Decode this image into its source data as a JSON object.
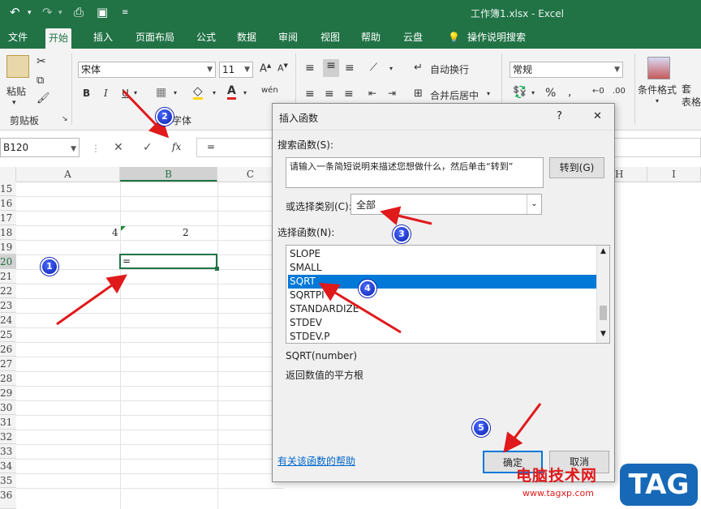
{
  "title_bar": {
    "title": "工作簿1.xlsx  -  Excel"
  },
  "tabs": [
    {
      "label": "文件"
    },
    {
      "label": "开始"
    },
    {
      "label": "插入"
    },
    {
      "label": "页面布局"
    },
    {
      "label": "公式"
    },
    {
      "label": "数据"
    },
    {
      "label": "审阅"
    },
    {
      "label": "视图"
    },
    {
      "label": "帮助"
    },
    {
      "label": "云盘"
    },
    {
      "label": "操作说明搜索"
    }
  ],
  "ribbon": {
    "paste_label": "粘贴",
    "clipboard_label": "剪贴板",
    "font_group_label": "字体",
    "font_name": "宋体",
    "font_size": "11",
    "wrap_text": "自动换行",
    "merge_center": "合并后居中",
    "number_format": "常规",
    "conditional_format": "条件格式",
    "table_format_partial": "套\n表格",
    "bold": "B",
    "italic": "I",
    "underline": "U",
    "font_color": "A",
    "wen": "wén",
    "percent": "%"
  },
  "formula_bar": {
    "name_box": "B120",
    "fx": "fx",
    "formula": "="
  },
  "columns": [
    "A",
    "B",
    "C",
    "H",
    "I"
  ],
  "rows": [
    "15",
    "16",
    "17",
    "18",
    "19",
    "20",
    "21",
    "22",
    "23",
    "24",
    "25",
    "26",
    "27",
    "28",
    "29",
    "30",
    "31",
    "32",
    "33",
    "34",
    "35",
    "36"
  ],
  "cells": {
    "A18": "4",
    "B18": "2",
    "B20": "="
  },
  "dialog": {
    "title": "插入函数",
    "help": "?",
    "close": "✕",
    "search_label": "搜索函数(S):",
    "search_text": "请输入一条简短说明来描述您想做什么，然后单击“转到”",
    "go_button": "转到(G)",
    "category_label": "或选择类别(C):",
    "category_value": "全部",
    "select_label": "选择函数(N):",
    "functions": [
      "SLOPE",
      "SMALL",
      "SQRT",
      "SQRTPI",
      "STANDARDIZE",
      "STDEV",
      "STDEV.P"
    ],
    "selected_function": "SQRT",
    "signature": "SQRT(number)",
    "description": "返回数值的平方根",
    "help_link": "有关该函数的帮助",
    "ok_button": "确定",
    "cancel_button": "取消"
  },
  "annotations": {
    "b1": "1",
    "b2": "2",
    "b3": "3",
    "b4": "4",
    "b5": "5",
    "arrow_color": "#e0191b",
    "badge_color": "#1a2fd0"
  },
  "watermark": {
    "site_cn": "电脑技术网",
    "site_url": "www.tagxp.com",
    "logo": "TAG"
  },
  "colors": {
    "excel_green": "#217346",
    "selection_blue": "#0078d7"
  }
}
